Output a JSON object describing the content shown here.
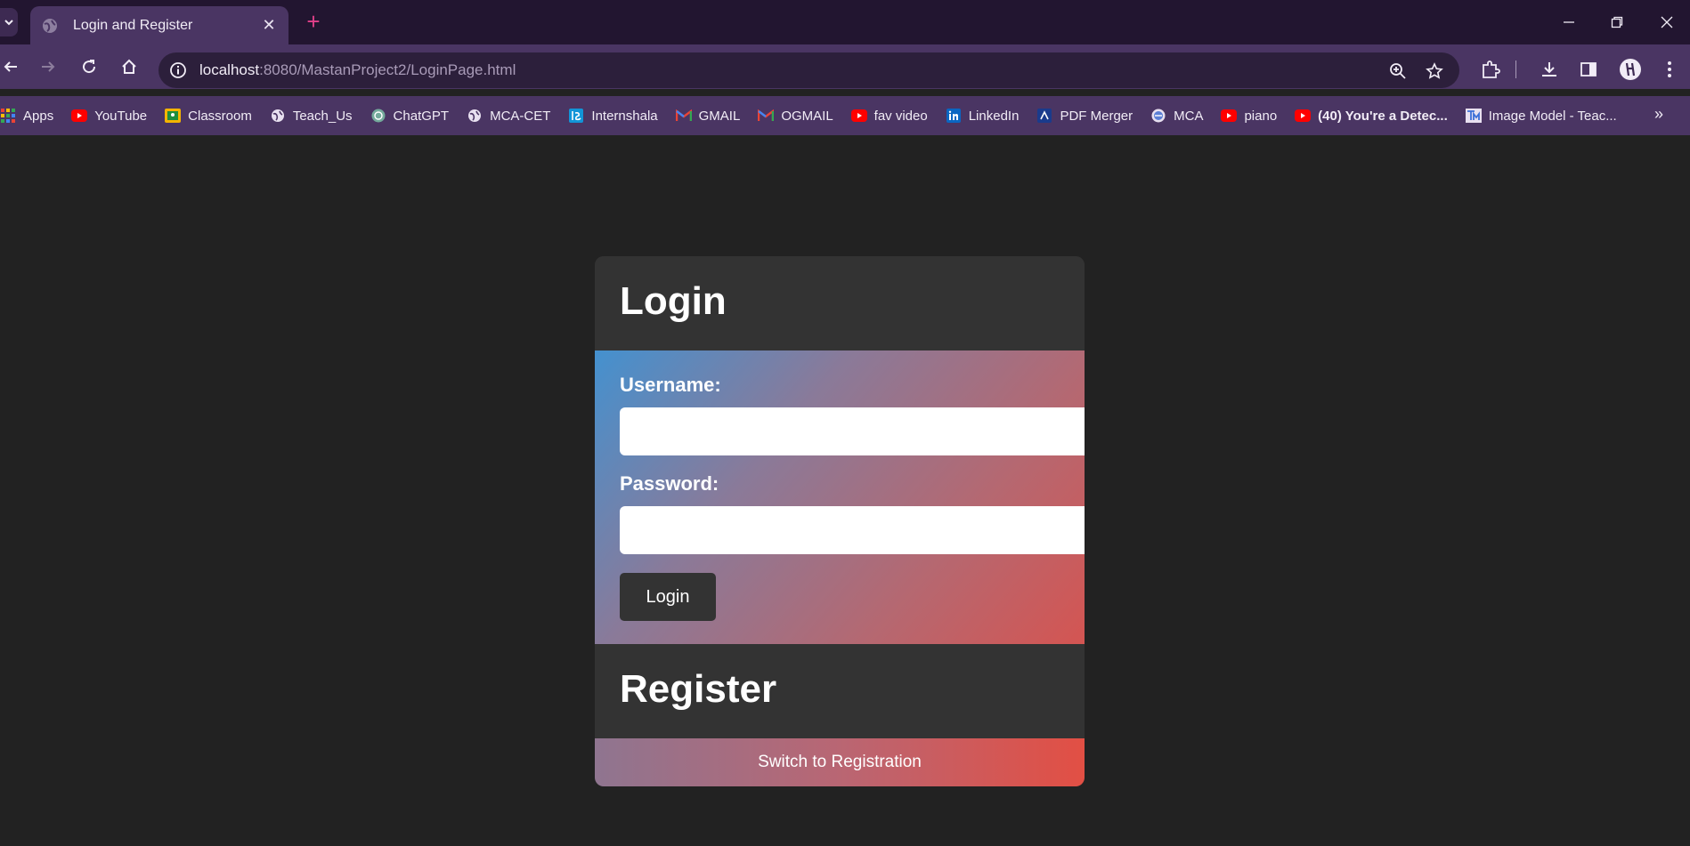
{
  "browser": {
    "tab_title": "Login and Register",
    "tab_close": "✕",
    "new_tab": "+",
    "url_host": "localhost",
    "url_path": ":8080/MastanProject2/LoginPage.html",
    "bookmarks": [
      {
        "label": "Apps",
        "icon": "apps-grid-icon",
        "color": "#4285f4"
      },
      {
        "label": "YouTube",
        "icon": "youtube-icon",
        "color": "#ff0000"
      },
      {
        "label": "Classroom",
        "icon": "classroom-icon",
        "color": "#f4b400"
      },
      {
        "label": "Teach_Us",
        "icon": "globe-icon",
        "color": "#e8e0f0"
      },
      {
        "label": "ChatGPT",
        "icon": "chatgpt-icon",
        "color": "#74aa9c"
      },
      {
        "label": "MCA-CET",
        "icon": "globe-icon",
        "color": "#e8e0f0"
      },
      {
        "label": "Internshala",
        "icon": "internshala-icon",
        "color": "#1295d8"
      },
      {
        "label": "GMAIL",
        "icon": "gmail-icon",
        "color": "#ea4335"
      },
      {
        "label": "OGMAIL",
        "icon": "gmail-icon",
        "color": "#ea4335"
      },
      {
        "label": "fav video",
        "icon": "youtube-icon",
        "color": "#ff0000"
      },
      {
        "label": "LinkedIn",
        "icon": "linkedin-icon",
        "color": "#0a66c2"
      },
      {
        "label": "PDF Merger",
        "icon": "pdf-merger-icon",
        "color": "#1a3b8c"
      },
      {
        "label": "MCA",
        "icon": "mca-icon",
        "color": "#5b7fd6"
      },
      {
        "label": "piano",
        "icon": "youtube-icon",
        "color": "#ff0000"
      },
      {
        "label": "(40) You're a Detec...",
        "icon": "youtube-icon",
        "color": "#ff0000"
      },
      {
        "label": "Image Model - Teac...",
        "icon": "teachable-machine-icon",
        "color": "#3c6fd8"
      }
    ],
    "more_bookmarks": "»"
  },
  "login": {
    "heading": "Login",
    "username_label": "Username:",
    "username_value": "",
    "password_label": "Password:",
    "password_value": "",
    "button": "Login"
  },
  "register": {
    "heading": "Register",
    "switch_label": "Switch to Registration"
  }
}
